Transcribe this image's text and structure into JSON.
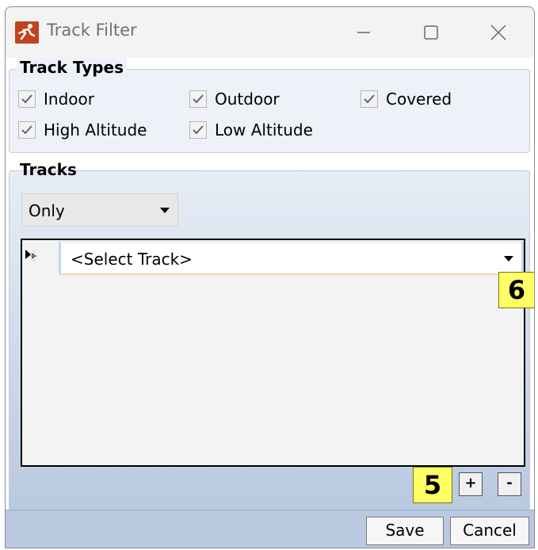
{
  "window": {
    "title": "Track Filter"
  },
  "track_types": {
    "legend": "Track Types",
    "options": [
      {
        "label": "Indoor",
        "checked": true
      },
      {
        "label": "Outdoor",
        "checked": true
      },
      {
        "label": "Covered",
        "checked": true
      },
      {
        "label": "High Altitude",
        "checked": true
      },
      {
        "label": "Low Altitude",
        "checked": true
      }
    ]
  },
  "tracks": {
    "legend": "Tracks",
    "mode_selected": "Only",
    "track_select_placeholder": "<Select Track>",
    "add_label": "+",
    "remove_label": "-"
  },
  "annotations": {
    "callout_6": "6",
    "callout_5": "5"
  },
  "footer": {
    "save_label": "Save",
    "cancel_label": "Cancel"
  },
  "colors": {
    "callout_bg": "#ffff66",
    "group_gradient_bottom": "#b9c9e0"
  }
}
